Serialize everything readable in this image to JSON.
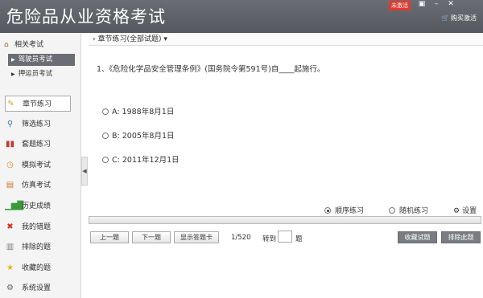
{
  "app": {
    "title": "危险品从业资格考试",
    "badge": "未激活",
    "buy_label": "购买激活",
    "buy_icon": "cart-icon",
    "window_controls": [
      "▣",
      "–",
      "✕"
    ]
  },
  "sidebar": {
    "section_title": "相关考试",
    "sub_items": [
      {
        "label": "驾驶员考试",
        "active": true
      },
      {
        "label": "押运员考试",
        "active": false
      }
    ],
    "nav": [
      {
        "label": "章节练习",
        "icon": "pencil-icon",
        "glyph": "✎",
        "color": "#d9a020",
        "active": true
      },
      {
        "label": "筛选练习",
        "icon": "magnifier-icon",
        "glyph": "🔍",
        "color": "#3a6ea5",
        "active": false
      },
      {
        "label": "套题练习",
        "icon": "books-icon",
        "glyph": "▮",
        "color": "#c0392b",
        "active": false
      },
      {
        "label": "模拟考试",
        "icon": "clock-icon",
        "glyph": "◷",
        "color": "#d98c1a",
        "active": false
      },
      {
        "label": "仿真考试",
        "icon": "document-icon",
        "glyph": "▤",
        "color": "#c77a2a",
        "active": false
      },
      {
        "label": "历史成绩",
        "icon": "bar-chart-icon",
        "glyph": "▇",
        "color": "#3a9a3a",
        "active": false
      },
      {
        "label": "我的错题",
        "icon": "red-x-icon",
        "glyph": "✖",
        "color": "#d03020",
        "active": false
      },
      {
        "label": "排除的题",
        "icon": "trash-icon",
        "glyph": "🗑",
        "color": "#7a7a7a",
        "active": false
      },
      {
        "label": "收藏的题",
        "icon": "star-icon",
        "glyph": "★",
        "color": "#e8b020",
        "active": false
      },
      {
        "label": "系统设置",
        "icon": "gear-icon",
        "glyph": "⚙",
        "color": "#666666",
        "active": false
      }
    ]
  },
  "main": {
    "breadcrumb": "章节练习(全部试题)",
    "question": "1、《危险化学品安全管理条例》(国务院令第591号)自____起施行。",
    "options": [
      "A: 1988年8月1日",
      "B: 2005年8月1日",
      "C: 2011年12月1日"
    ],
    "modes": [
      {
        "label": "顺序练习",
        "checked": true
      },
      {
        "label": "随机练习",
        "checked": false
      }
    ],
    "settings_label": "设置",
    "buttons": {
      "prev": "上一题",
      "next": "下一题",
      "answer_card": "显示答题卡",
      "favorite": "收藏试题",
      "exclude": "排除此题"
    },
    "page_indicator": "1/520",
    "goto_label": "转到",
    "goto_unit": "题"
  }
}
